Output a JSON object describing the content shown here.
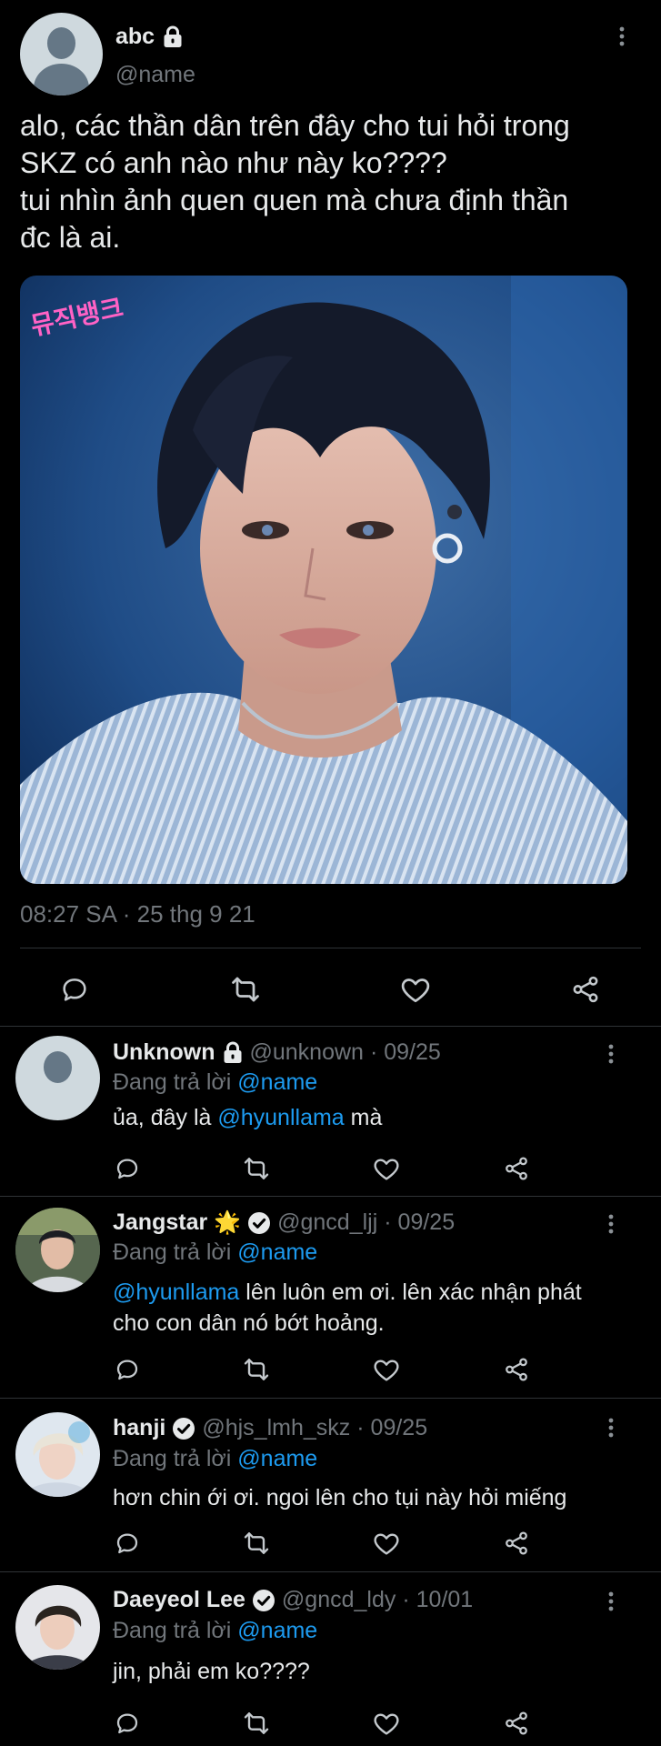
{
  "tweet": {
    "display_name": "abc",
    "handle": "@name",
    "text_lines": [
      "alo, các thần dân trên đây cho tui hỏi trong",
      "SKZ có anh nào như này ko????",
      "tui nhìn ảnh quen quen mà chưa định thần",
      "đc là ai."
    ],
    "media_watermark": "뮤직뱅크",
    "timestamp": "08:27 SA · 25 thg 9 21"
  },
  "replies": [
    {
      "display_name": "Unknown",
      "handle": "@unknown",
      "date": "· 09/25",
      "replying_prefix": "Đang trả lời",
      "replying_to": "@name",
      "text_before": "ủa, đây là",
      "mention": "@hyunllama",
      "text_after": "mà"
    },
    {
      "display_name": "Jangstar",
      "emoji": "🌟",
      "handle": "@gncd_ljj",
      "date": "· 09/25",
      "replying_prefix": "Đang trả lời",
      "replying_to": "@name",
      "mention": "@hyunllama",
      "line1_rest": "lên luôn em ơi. lên xác nhận phát",
      "line2": "cho con dân nó bớt hoảng."
    },
    {
      "display_name": "hanji",
      "handle": "@hjs_lmh_skz",
      "date": "· 09/25",
      "replying_prefix": "Đang trả lời",
      "replying_to": "@name",
      "text": "hơn chin ới ơi. ngoi lên cho tụi này hỏi miếng"
    },
    {
      "display_name": "Daeyeol Lee",
      "handle": "@gncd_ldy",
      "date": "· 10/01",
      "replying_prefix": "Đang trả lời",
      "replying_to": "@name",
      "text": "jin, phải em ko????"
    }
  ],
  "icons": {
    "reply": "reply-icon",
    "retweet": "retweet-icon",
    "like": "like-icon",
    "share": "share-icon",
    "more": "more-vertical-icon",
    "lock": "lock-icon",
    "verified": "verified-badge-icon"
  },
  "colors": {
    "background": "#000000",
    "text": "#e7e9ea",
    "muted": "#71767b",
    "link": "#1d9bf0",
    "divider": "#2f3336"
  }
}
